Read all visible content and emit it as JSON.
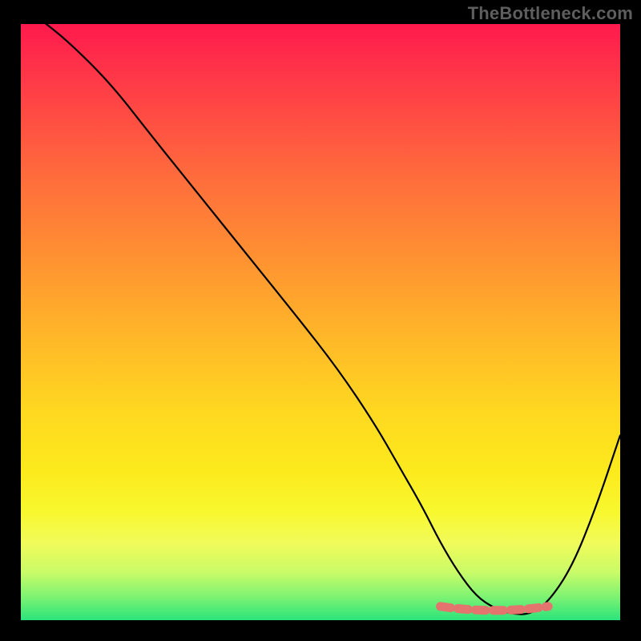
{
  "watermark": "TheBottleneck.com",
  "chart_data": {
    "type": "line",
    "title": "",
    "xlabel": "",
    "ylabel": "",
    "xlim": [
      0,
      100
    ],
    "ylim": [
      0,
      100
    ],
    "x": [
      3,
      8,
      15,
      22,
      30,
      38,
      46,
      53,
      59,
      63,
      67,
      70,
      73,
      76,
      79,
      82,
      85,
      88,
      92,
      96,
      100
    ],
    "values": [
      101,
      97,
      90,
      81,
      71,
      61,
      51,
      42,
      33,
      26,
      19,
      13,
      8,
      4,
      2,
      1,
      1,
      3,
      9,
      19,
      31
    ],
    "minimum_band": {
      "x_start": 70,
      "x_end": 88,
      "y": 1.5
    },
    "gradient_stops": [
      {
        "pos": 0.0,
        "color": "#ff1a4d"
      },
      {
        "pos": 0.25,
        "color": "#ff6a3d"
      },
      {
        "pos": 0.5,
        "color": "#ffb02b"
      },
      {
        "pos": 0.75,
        "color": "#fcea1d"
      },
      {
        "pos": 0.92,
        "color": "#c9fb68"
      },
      {
        "pos": 1.0,
        "color": "#2be47b"
      }
    ]
  }
}
